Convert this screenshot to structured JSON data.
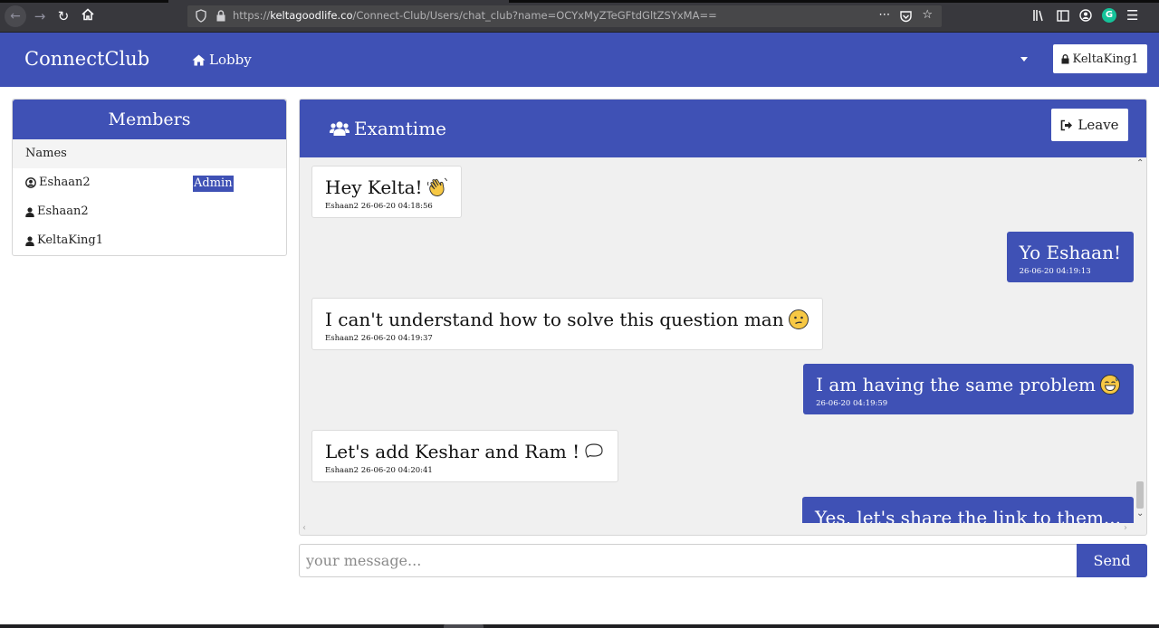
{
  "browser": {
    "url_prefix": "https://",
    "url_domain": "keltagoodlife.co",
    "url_path": "/Connect-Club/Users/chat_club?name=OCYxMyZTeGFtdGltZSYxMA==",
    "icons": [
      "back-icon",
      "forward-icon",
      "reload-icon",
      "home-icon",
      "shield-icon",
      "lock-icon",
      "more-icon",
      "pocket-icon",
      "star-icon",
      "library-icon",
      "sidebar-icon",
      "account-icon",
      "grammarly-icon",
      "menu-icon"
    ]
  },
  "navbar": {
    "brand": "ConnectClub",
    "lobby_label": "Lobby",
    "user_label": "KeltaKing1",
    "accent": "#3f51b5"
  },
  "members": {
    "title": "Members",
    "names_header": "Names",
    "list": [
      {
        "name": "Eshaan2",
        "role": "Admin",
        "icon": "user-circle-icon"
      },
      {
        "name": "Eshaan2",
        "role": "",
        "icon": "user-icon"
      },
      {
        "name": "KeltaKing1",
        "role": "",
        "icon": "user-icon"
      }
    ]
  },
  "chat": {
    "room_name": "Examtime",
    "leave_label": "Leave",
    "messages": [
      {
        "direction": "in",
        "text": "Hey Kelta!",
        "emoji": "waving-hand",
        "meta": "Eshaan2 26-06-20 04:18:56"
      },
      {
        "direction": "out",
        "text": "Yo Eshaan!",
        "emoji": "",
        "meta": "26-06-20 04:19:13"
      },
      {
        "direction": "in",
        "text": "I can't understand how to solve this question man",
        "emoji": "confused-face",
        "meta": "Eshaan2 26-06-20 04:19:37"
      },
      {
        "direction": "out",
        "text": "I am having the same problem",
        "emoji": "grinning-sweat-face",
        "meta": "26-06-20 04:19:59"
      },
      {
        "direction": "in",
        "text": "Let's add Keshar and Ram !",
        "emoji": "speech-bubble",
        "meta": "Eshaan2 26-06-20 04:20:41"
      },
      {
        "direction": "out",
        "text": "Yes, let's share the link to them...",
        "emoji": "",
        "meta": ""
      }
    ]
  },
  "composer": {
    "placeholder": "your message...",
    "value": "",
    "send_label": "Send"
  }
}
